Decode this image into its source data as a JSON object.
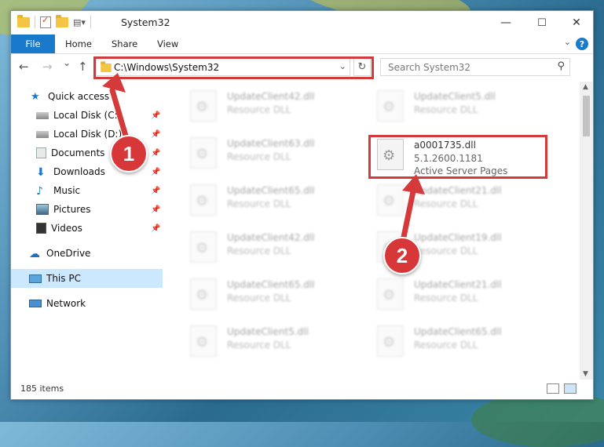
{
  "window": {
    "title": "System32",
    "min_glyph": "—",
    "max_glyph": "☐",
    "close_glyph": "✕"
  },
  "ribbon": {
    "tabs": [
      "File",
      "Home",
      "Share",
      "View"
    ],
    "help_glyph": "?"
  },
  "nav": {
    "back_glyph": "←",
    "forward_glyph": "→",
    "recent_glyph": "⌄",
    "up_glyph": "↑",
    "address": "C:\\Windows\\System32",
    "refresh_glyph": "↻",
    "search_placeholder": "Search System32"
  },
  "sidebar": {
    "items": [
      {
        "label": "Quick access",
        "icon": "star-icon",
        "pinned": false
      },
      {
        "label": "Local Disk (C:)",
        "icon": "drive-icon",
        "pinned": true
      },
      {
        "label": "Local Disk (D:)",
        "icon": "drive-icon",
        "pinned": true
      },
      {
        "label": "Documents",
        "icon": "documents-icon",
        "pinned": true
      },
      {
        "label": "Downloads",
        "icon": "download-icon",
        "pinned": true
      },
      {
        "label": "Music",
        "icon": "music-icon",
        "pinned": true
      },
      {
        "label": "Pictures",
        "icon": "pictures-icon",
        "pinned": true
      },
      {
        "label": "Videos",
        "icon": "videos-icon",
        "pinned": true
      },
      {
        "label": "OneDrive",
        "icon": "onedrive-icon",
        "pinned": false
      },
      {
        "label": "This PC",
        "icon": "this-pc-icon",
        "pinned": false,
        "selected": true
      },
      {
        "label": "Network",
        "icon": "network-icon",
        "pinned": false
      }
    ]
  },
  "files": {
    "left": [
      {
        "name": "UpdateClient42.dll",
        "type": "Resource DLL"
      },
      {
        "name": "UpdateClient63.dll",
        "type": "Resource DLL"
      },
      {
        "name": "UpdateClient65.dll",
        "type": "Resource DLL"
      },
      {
        "name": "UpdateClient42.dll",
        "type": "Resource DLL"
      },
      {
        "name": "UpdateClient65.dll",
        "type": "Resource DLL"
      },
      {
        "name": "UpdateClient5.dll",
        "type": "Resource DLL"
      }
    ],
    "right": [
      {
        "name": "UpdateClient5.dll",
        "type": "Resource DLL"
      },
      {
        "name": "UpdateClient21.dll",
        "type": "Resource DLL"
      },
      {
        "name": "UpdateClient19.dll",
        "type": "Resource DLL"
      },
      {
        "name": "UpdateClient21.dll",
        "type": "Resource DLL"
      },
      {
        "name": "UpdateClient65.dll",
        "type": "Resource DLL"
      }
    ],
    "highlighted": {
      "name": "a0001735.dll",
      "version": "5.1.2600.1181",
      "type": "Active Server Pages"
    }
  },
  "status": {
    "item_count": "185 items"
  },
  "callouts": [
    "1",
    "2"
  ],
  "colors": {
    "accent": "#1979ca",
    "highlight_red": "#d53a3a",
    "selected_bg": "#cce8ff"
  }
}
